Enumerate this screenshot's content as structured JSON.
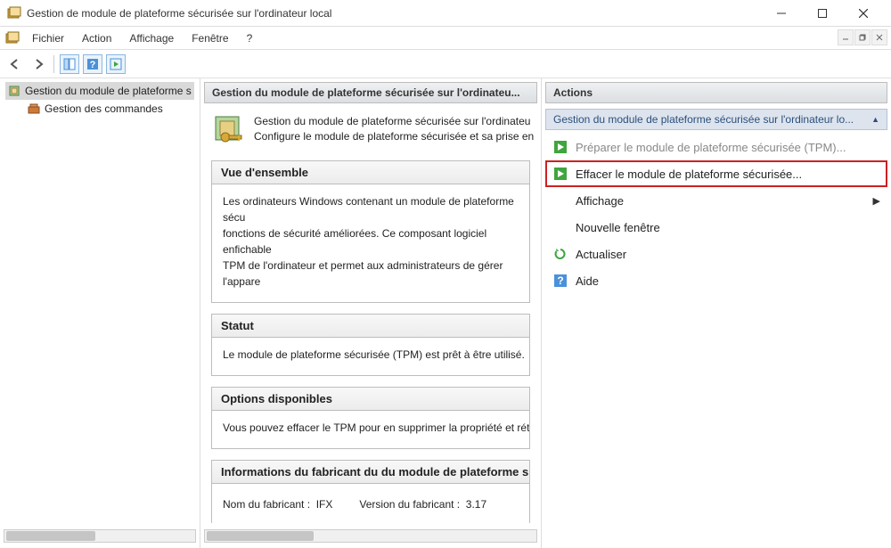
{
  "window": {
    "title": "Gestion de module de plateforme sécurisée sur l'ordinateur local"
  },
  "menu": {
    "file": "Fichier",
    "action": "Action",
    "view": "Affichage",
    "window": "Fenêtre",
    "help": "?"
  },
  "tree": {
    "root": "Gestion du module de plateforme s",
    "child": "Gestion des commandes"
  },
  "center": {
    "header": "Gestion du module de plateforme sécurisée sur l'ordinateu...",
    "intro_line1": "Gestion du module de plateforme sécurisée sur l'ordinateu",
    "intro_line2": "Configure le module de plateforme sécurisée et sa prise en",
    "sections": {
      "overview_title": "Vue d'ensemble",
      "overview_body": "Les ordinateurs Windows contenant un module de plateforme sécu\nfonctions de sécurité améliorées. Ce composant logiciel enfichable\nTPM de l'ordinateur et permet aux administrateurs de gérer l'appare",
      "status_title": "Statut",
      "status_body": "Le module de plateforme sécurisée (TPM) est prêt à être utilisé.",
      "options_title": "Options disponibles",
      "options_body": "Vous pouvez effacer le TPM pour en supprimer la propriété et réta",
      "vendor_title": "Informations du fabricant du du module de plateforme s",
      "vendor_name_label": "Nom du fabricant :",
      "vendor_name_value": "IFX",
      "vendor_version_label": "Version du fabricant :",
      "vendor_version_value": "3.17"
    }
  },
  "actions": {
    "header": "Actions",
    "group": "Gestion du module de plateforme sécurisée sur l'ordinateur lo...",
    "prepare": "Préparer le module de plateforme sécurisée (TPM)...",
    "clear": "Effacer le module de plateforme sécurisée...",
    "view": "Affichage",
    "newwindow": "Nouvelle fenêtre",
    "refresh": "Actualiser",
    "help": "Aide"
  }
}
